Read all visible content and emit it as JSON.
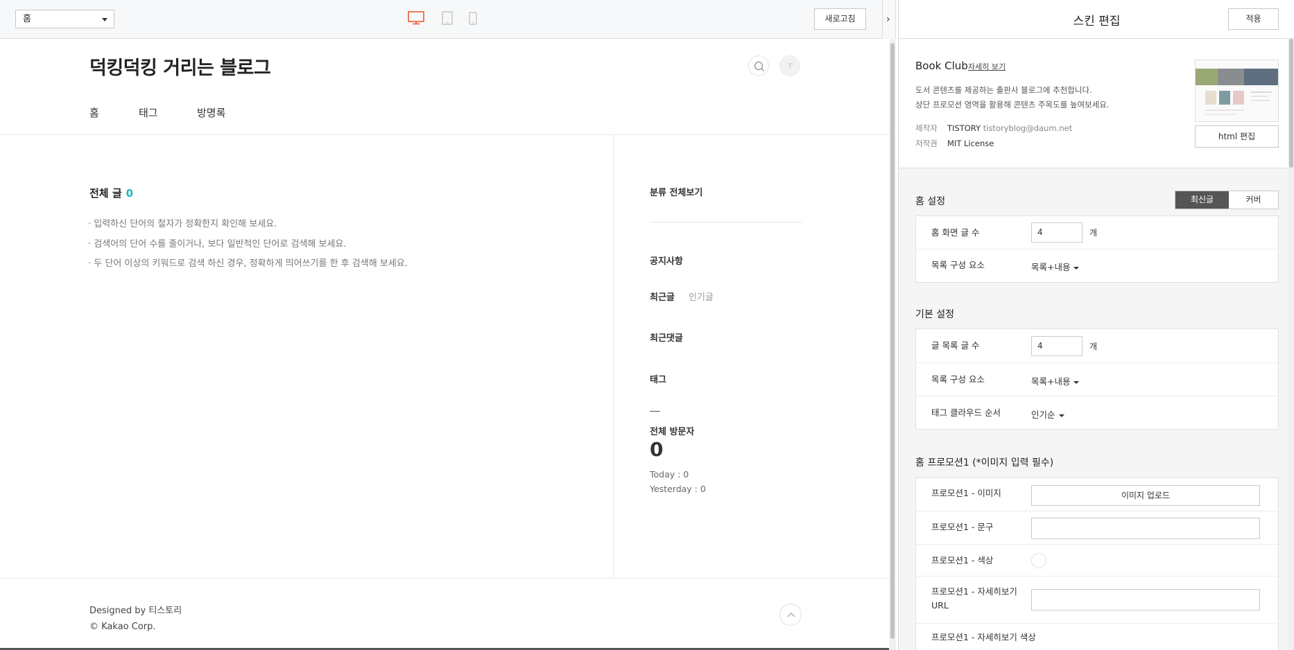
{
  "toolbar": {
    "page_select": "홈",
    "refresh_label": "새로고침",
    "collapse_glyph": "›",
    "accent_color": "#f04e1f"
  },
  "blog": {
    "title": "덕킹덕킹 거리는 블로그",
    "nav": [
      "홈",
      "태그",
      "방명록"
    ],
    "posts_label": "전체 글",
    "posts_count": "0",
    "tips": [
      "· 입력하신 단어의 철자가 정확한지 확인해 보세요.",
      "· 검색어의 단어 수를 줄이거나, 보다 일반적인 단어로 검색해 보세요.",
      "· 두 단어 이상의 키워드로 검색 하신 경우, 정확하게 띄어쓰기를 한 후 검색해 보세요."
    ],
    "sidebar": {
      "category": "분류 전체보기",
      "notice": "공지사항",
      "recent_posts": "최근글",
      "popular_posts": "인기글",
      "recent_comments": "최근댓글",
      "tags": "태그",
      "visitors_label": "전체 방문자",
      "visitors_total": "0",
      "today": "Today : 0",
      "yesterday": "Yesterday : 0"
    },
    "footer": {
      "designed": "Designed by 티스토리",
      "copyright": "© Kakao Corp."
    }
  },
  "panel": {
    "title": "스킨 편집",
    "apply_label": "적용",
    "skin": {
      "name": "Book Club",
      "detail_link": "자세히 보기",
      "desc1": "도서 콘텐츠를 제공하는 출판사 블로그에 추천합니다.",
      "desc2": "상단 프로모션 영역을 활용해 콘텐츠 주목도를 높여보세요.",
      "maker_label": "제작자",
      "maker": "TISTORY",
      "maker_email": "tistoryblog@daum.net",
      "license_label": "저작권",
      "license": "MIT License",
      "html_edit_label": "html 편집"
    },
    "home": {
      "title": "홈 설정",
      "toggle_on": "최신글",
      "toggle_off": "커버",
      "rows": {
        "count_label": "홈 화면 글 수",
        "count_value": "4",
        "unit": "개",
        "list_label": "목록 구성 요소",
        "list_value": "목록+내용"
      }
    },
    "basic": {
      "title": "기본 설정",
      "rows": {
        "count_label": "글 목록 글 수",
        "count_value": "4",
        "unit": "개",
        "list_label": "목록 구성 요소",
        "list_value": "목록+내용",
        "tag_label": "태그 클라우드 순서",
        "tag_value": "인기순"
      }
    },
    "promo": {
      "title": "홈 프로모션1 (*이미지 입력 필수)",
      "rows": {
        "image_label": "프로모션1 - 이미지",
        "upload_label": "이미지 업로드",
        "text_label": "프로모션1 - 문구",
        "color_label": "프로모션1 - 색상",
        "url_label": "프로모션1 - 자세히보기 URL",
        "btn_color_label": "프로모션1 - 자세히보기 색상"
      }
    }
  }
}
